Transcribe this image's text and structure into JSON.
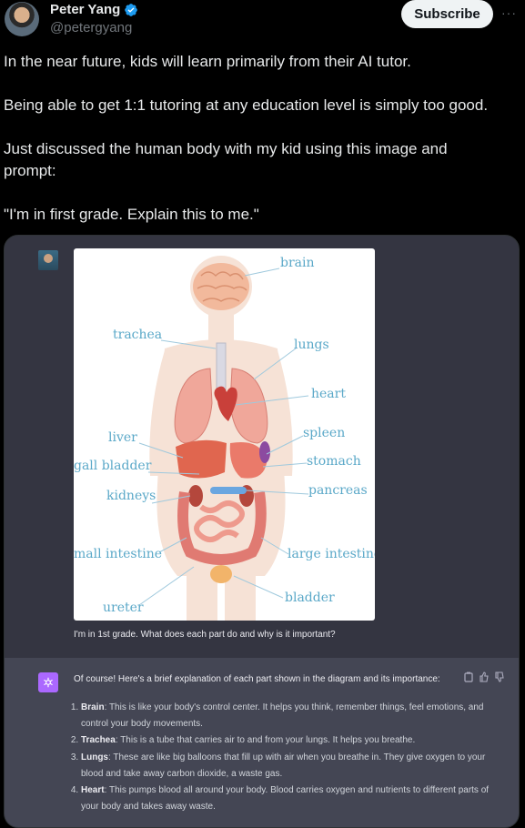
{
  "author": {
    "name": "Peter Yang",
    "handle": "@petergyang"
  },
  "header": {
    "subscribe_label": "Subscribe",
    "more_label": "···"
  },
  "tweet": {
    "paragraphs": [
      "In the near future, kids will learn primarily from their AI tutor.",
      "Being able to get 1:1 tutoring at any education level is simply too good.",
      "Just discussed the human body with my kid using this image and prompt:",
      "\"I'm in first grade. Explain this to me.\""
    ]
  },
  "diagram": {
    "labels": {
      "brain": "brain",
      "trachea": "trachea",
      "lungs": "lungs",
      "heart": "heart",
      "liver": "liver",
      "spleen": "spleen",
      "gall_bladder": "gall bladder",
      "stomach": "stomach",
      "kidneys": "kidneys",
      "pancreas": "pancreas",
      "small_intestine": "mall intestine",
      "large_intestine": "large intestine",
      "bladder": "bladder",
      "ureter": "ureter"
    },
    "colors": {
      "label": "#5aa8c8",
      "body": "#f3ddd0",
      "organ": "#e88b7a"
    }
  },
  "chat": {
    "user_prompt": "I'm in 1st grade. What does each part do and why is it important?",
    "assistant_intro": "Of course! Here's a brief explanation of each part shown in the diagram and its importance:",
    "items": [
      {
        "term": "Brain",
        "text": ": This is like your body's control center. It helps you think, remember things, feel emotions, and control your body movements."
      },
      {
        "term": "Trachea",
        "text": ": This is a tube that carries air to and from your lungs. It helps you breathe."
      },
      {
        "term": "Lungs",
        "text": ": These are like big balloons that fill up with air when you breathe in. They give oxygen to your blood and take away carbon dioxide, a waste gas."
      },
      {
        "term": "Heart",
        "text": ": This pumps blood all around your body. Blood carries oxygen and nutrients to different parts of your body and takes away waste."
      }
    ],
    "icons": [
      "copy-icon",
      "thumbs-up-icon",
      "thumbs-down-icon"
    ],
    "accent": "#ab68ff"
  }
}
